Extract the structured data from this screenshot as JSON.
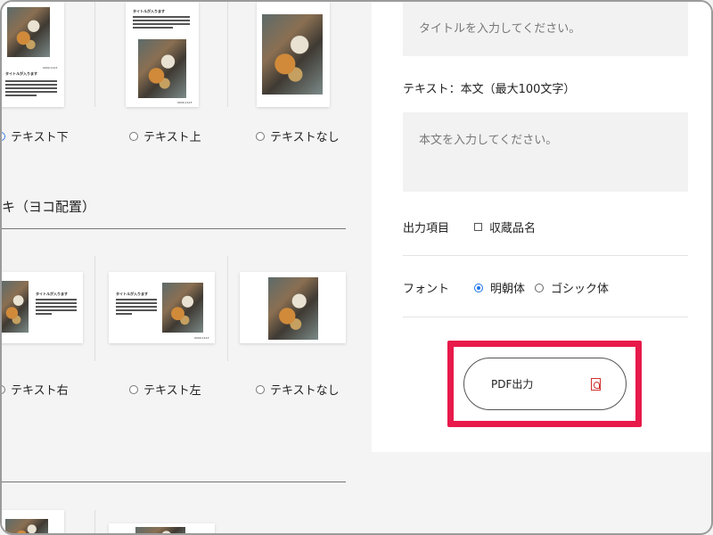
{
  "left": {
    "sample_title_text": "タイトルが入ります",
    "sample_code_text": "0000-1123",
    "row1_options": [
      "テキスト下",
      "テキスト上",
      "テキストなし"
    ],
    "section_title": "キ（ヨコ配置）",
    "row2_options": [
      "テキスト右",
      "テキスト左",
      "テキストなし"
    ]
  },
  "panel": {
    "title_placeholder": "タイトルを入力してください。",
    "body_label": "テキスト：本文（最大100文字）",
    "body_placeholder": "本文を入力してください。",
    "output_items_label": "出力項目",
    "collection_name_option": "収蔵品名",
    "font_label": "フォント",
    "font_options": [
      "明朝体",
      "ゴシック体"
    ],
    "font_selected": "明朝体",
    "pdf_button_label": "PDF出力"
  },
  "colors": {
    "highlight": "#e8194b",
    "radio_selected": "#1a73e8"
  }
}
